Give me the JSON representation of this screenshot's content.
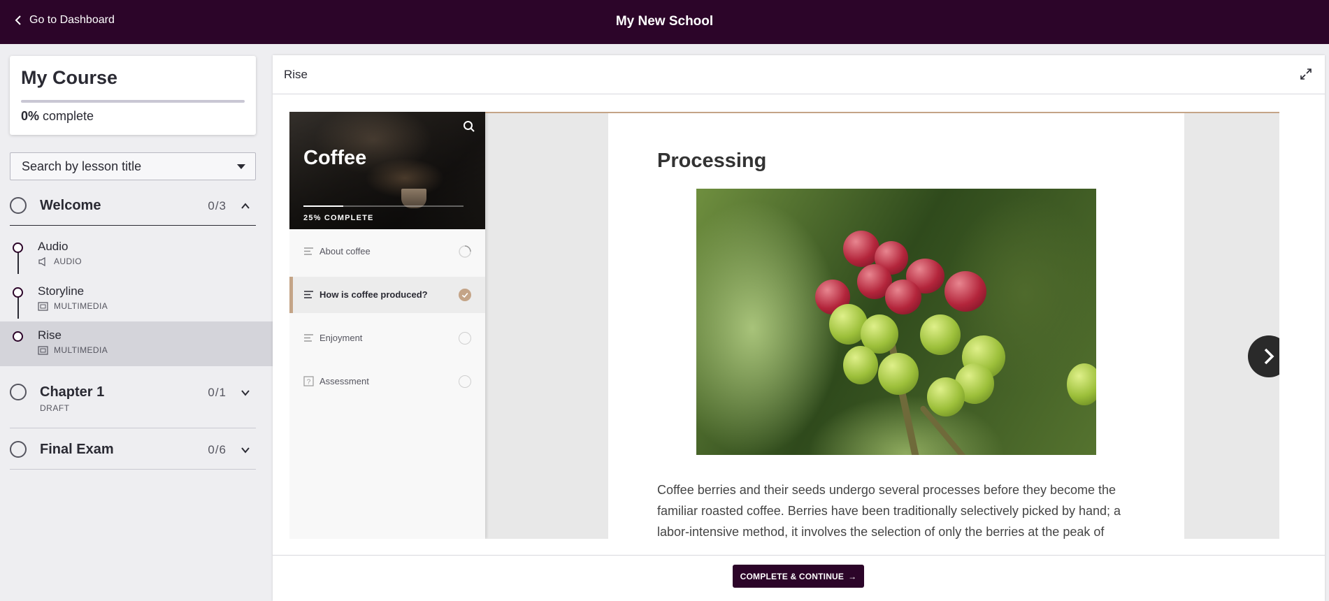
{
  "topbar": {
    "back_label": "Go to Dashboard",
    "school_name": "My New School"
  },
  "course": {
    "title": "My Course",
    "progress_pct": "0%",
    "progress_suffix": "complete",
    "progress_fraction": 0
  },
  "search": {
    "label": "Search by lesson title"
  },
  "sections": [
    {
      "title": "Welcome",
      "count": "0/3",
      "expanded": true,
      "lessons": [
        {
          "title": "Audio",
          "type": "AUDIO",
          "icon": "speaker-icon"
        },
        {
          "title": "Storyline",
          "type": "MULTIMEDIA",
          "icon": "multimedia-icon"
        },
        {
          "title": "Rise",
          "type": "MULTIMEDIA",
          "icon": "multimedia-icon",
          "active": true
        }
      ]
    },
    {
      "title": "Chapter 1",
      "count": "0/1",
      "subtitle": "DRAFT",
      "expanded": false
    },
    {
      "title": "Final Exam",
      "count": "0/6",
      "expanded": false
    }
  ],
  "main": {
    "title": "Rise",
    "rise": {
      "course_title": "Coffee",
      "progress_label": "25% COMPLETE",
      "progress_fraction": 0.25,
      "items": [
        {
          "label": "About coffee",
          "icon": "lines-icon",
          "state": "in-progress"
        },
        {
          "label": "How is coffee produced?",
          "icon": "lines-icon",
          "state": "complete",
          "active": true
        },
        {
          "label": "Enjoyment",
          "icon": "lines-icon",
          "state": "not-started"
        },
        {
          "label": "Assessment",
          "icon": "question-icon",
          "state": "not-started"
        }
      ],
      "accent": "#c4a487"
    },
    "page": {
      "heading": "Processing",
      "image": "coffee-berries-photo",
      "body": "Coffee berries and their seeds undergo several processes before they become the familiar roasted coffee. Berries have been traditionally selectively picked by hand; a labor-intensive method, it involves the selection of only the berries at the peak of"
    },
    "footer": {
      "cta_label": "COMPLETE & CONTINUE"
    }
  },
  "colors": {
    "brand": "#2c0529",
    "sidebar_bg": "#eeeef1"
  }
}
